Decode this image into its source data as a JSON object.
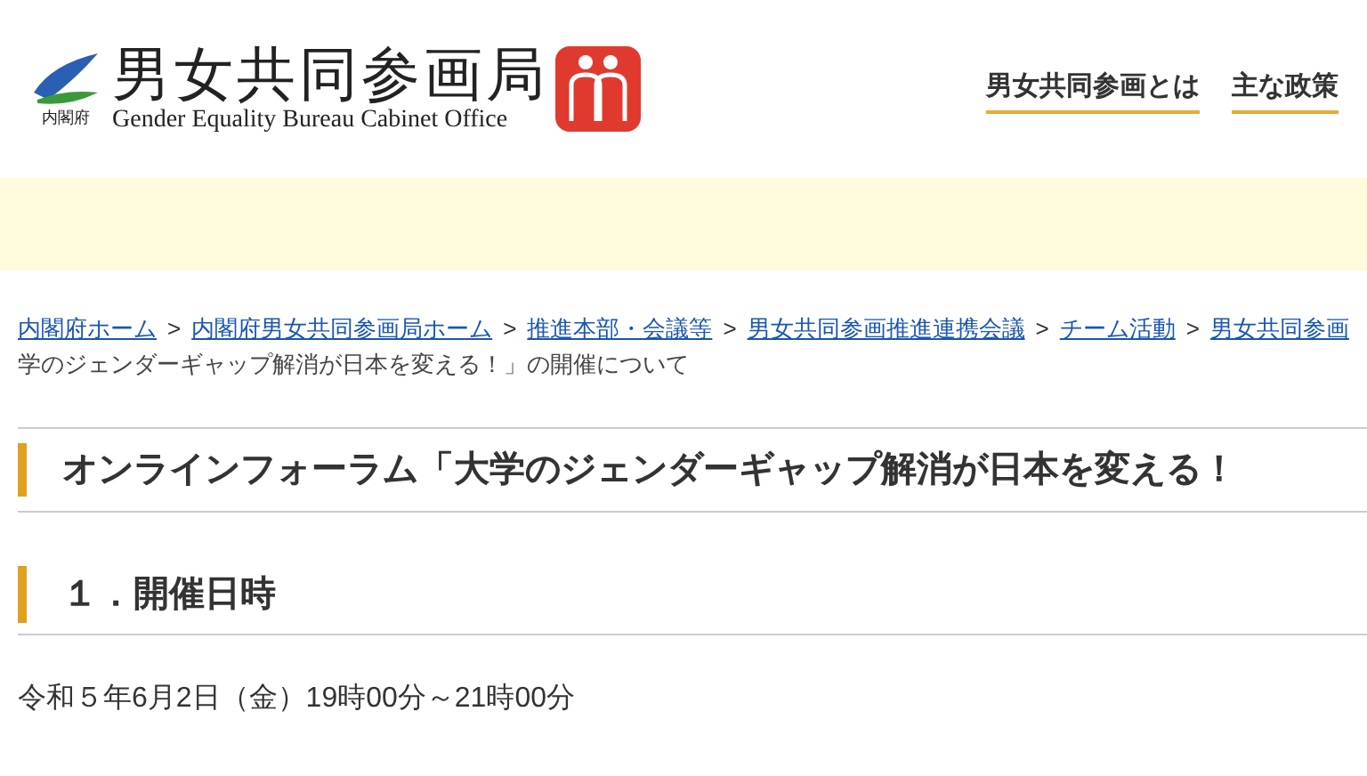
{
  "header": {
    "logo": {
      "org": "内閣府",
      "title": "男女共同参画局",
      "subtitle": "Gender Equality Bureau Cabinet Office"
    },
    "nav": [
      {
        "label": "男女共同参画とは"
      },
      {
        "label": "主な政策"
      }
    ]
  },
  "breadcrumb": [
    {
      "kind": "link",
      "label": "内閣府ホーム"
    },
    {
      "kind": "separator",
      "label": ">"
    },
    {
      "kind": "link",
      "label": "内閣府男女共同参画局ホーム"
    },
    {
      "kind": "separator",
      "label": ">"
    },
    {
      "kind": "link",
      "label": "推進本部・会議等"
    },
    {
      "kind": "separator",
      "label": ">"
    },
    {
      "kind": "link",
      "label": "男女共同参画推進連携会議"
    },
    {
      "kind": "separator",
      "label": ">"
    },
    {
      "kind": "link",
      "label": "チーム活動"
    },
    {
      "kind": "separator",
      "label": ">"
    },
    {
      "kind": "link",
      "label": "男女共同参画"
    }
  ],
  "breadcrumb_current": "学のジェンダーギャップ解消が日本を変える！」の開催について",
  "page_title": "オンラインフォーラム「大学のジェンダーギャップ解消が日本を変える！",
  "sections": [
    {
      "heading": "１．開催日時",
      "body": "令和５年6月2日（金）19時00分～21時00分"
    }
  ]
}
